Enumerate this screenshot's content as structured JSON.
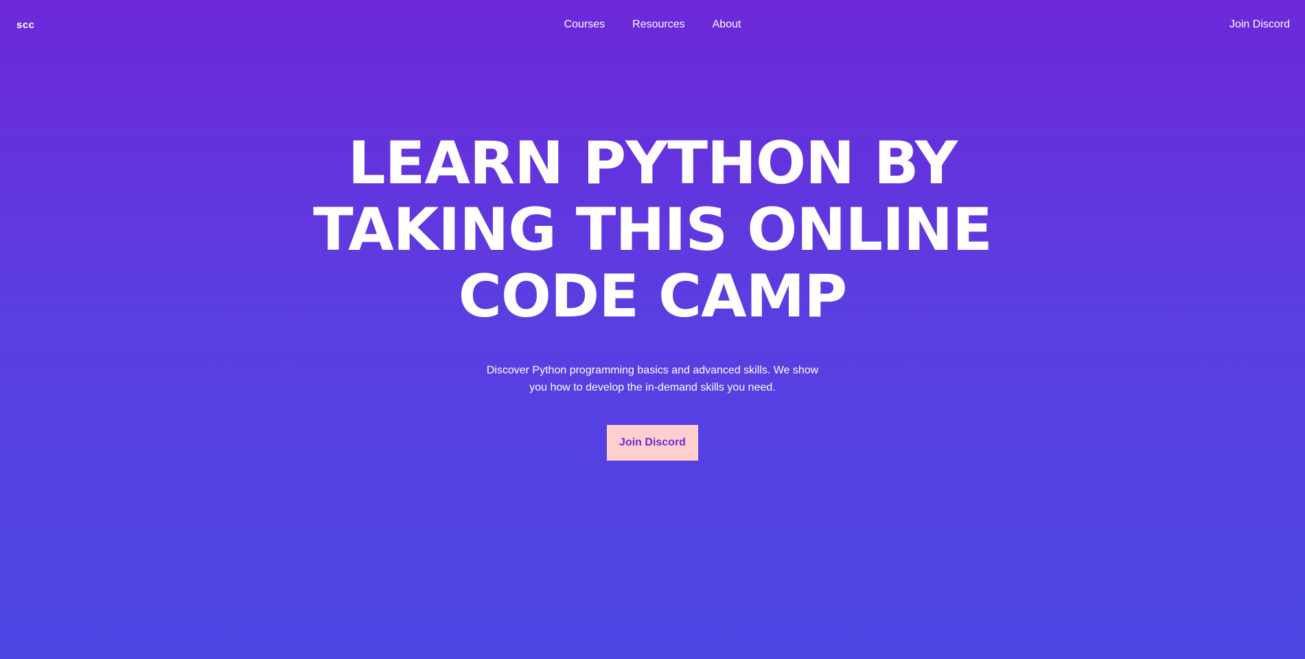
{
  "colors": {
    "gradient_top": "#6d28d9",
    "gradient_bottom": "#4c46e3",
    "cta_background": "#ffcfcf",
    "cta_text": "#6d28d9",
    "text": "#ffffff"
  },
  "header": {
    "logo": "scc",
    "nav": [
      {
        "label": "Courses"
      },
      {
        "label": "Resources"
      },
      {
        "label": "About"
      }
    ],
    "cta_label": "Join Discord"
  },
  "hero": {
    "title": "LEARN PYTHON BY TAKING THIS ONLINE CODE CAMP",
    "subtitle": "Discover Python programming basics and advanced skills. We show you how to develop the in-demand skills you need.",
    "cta_label": "Join Discord"
  }
}
